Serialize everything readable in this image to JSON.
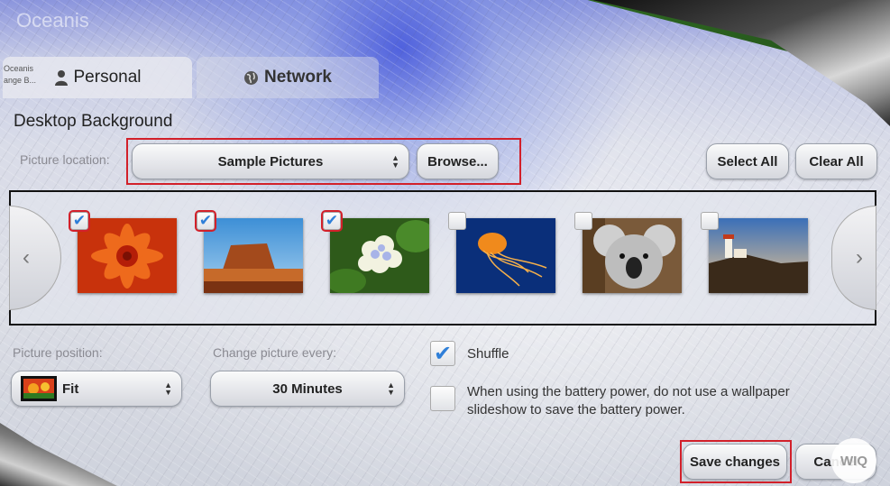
{
  "app": {
    "title": "Oceanis"
  },
  "tabs": {
    "ghost_lines": [
      "Oceanis",
      "ange B..."
    ],
    "personal": "Personal",
    "network": "Network"
  },
  "section": {
    "title": "Desktop Background"
  },
  "location": {
    "label": "Picture location:",
    "value": "Sample Pictures",
    "browse": "Browse...",
    "select_all": "Select All",
    "clear_all": "Clear All"
  },
  "thumbnails": [
    {
      "name": "flower-orange",
      "checked": true
    },
    {
      "name": "desert",
      "checked": true
    },
    {
      "name": "hydrangeas",
      "checked": true
    },
    {
      "name": "jellyfish",
      "checked": false
    },
    {
      "name": "koala",
      "checked": false
    },
    {
      "name": "lighthouse",
      "checked": false
    }
  ],
  "position": {
    "label": "Picture position:",
    "value": "Fit"
  },
  "interval": {
    "label": "Change picture every:",
    "value": "30 Minutes"
  },
  "options": {
    "shuffle": {
      "label": "Shuffle",
      "checked": true
    },
    "battery_line1": "When using the battery power, do not use a wallpaper",
    "battery_line2": "slideshow to save the battery power.",
    "battery_checked": false
  },
  "footer": {
    "save": "Save changes",
    "cancel": "Cancel"
  },
  "watermark": "WIQ",
  "colors": {
    "accent_red": "#d2202a",
    "check_blue": "#2f7fd8"
  }
}
